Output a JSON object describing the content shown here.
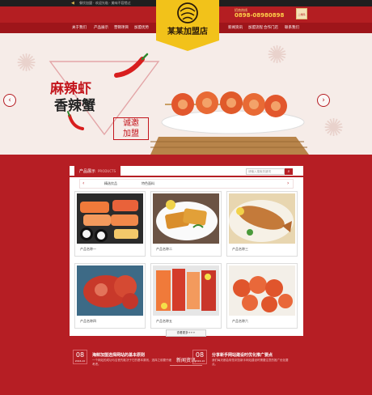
{
  "topbar": {
    "speaker_icon": "speaker-icon",
    "text": "餐饮加盟 · 欢迎光临 · 美味不容错过"
  },
  "header": {
    "brand": "某某加盟店",
    "hotline_label": "招商热线",
    "hotline": "0898-08980898",
    "qr_label": "二维码"
  },
  "nav": {
    "items": [
      "关于我们",
      "产品展示",
      "营销项目",
      "加盟优势",
      "新闻资讯",
      "加盟流程",
      "合作门店",
      "联系我们"
    ]
  },
  "banner": {
    "line1": "麻辣虾",
    "line2": "香辣蟹",
    "stamp1": "诚邀",
    "stamp2": "加盟",
    "prev_icon": "chevron-left-icon",
    "next_icon": "chevron-right-icon"
  },
  "products": {
    "title": "产品展示",
    "subtitle": "PRODUCTS",
    "search_placeholder": "请输入搜索关键词",
    "categories": [
      "精选饮品",
      "特色面料"
    ],
    "items": [
      {
        "label": "产品名称一"
      },
      {
        "label": "产品名称二"
      },
      {
        "label": "产品名称三"
      },
      {
        "label": "产品名称四"
      },
      {
        "label": "产品名称五"
      },
      {
        "label": "产品名称六"
      }
    ],
    "more": "查看更多+++"
  },
  "news": {
    "title": "新闻资讯",
    "items": [
      {
        "day": "08",
        "year": "2016-10",
        "title": "海鲜加盟选择网站的基本原则",
        "summary": "一个网站的成功与否首先取决于它的基本原则，选择之前要仔细考虑。"
      },
      {
        "day": "08",
        "year": "2016-10",
        "title": "分享新手网站建设时优化推广要点",
        "summary": "我们每天都会带您浏览新手网站建设时需要注意的推广优化要点。"
      }
    ]
  },
  "colors": {
    "primary": "#b61e24",
    "dark": "#1f1f1f",
    "gold": "#f2c21a"
  }
}
